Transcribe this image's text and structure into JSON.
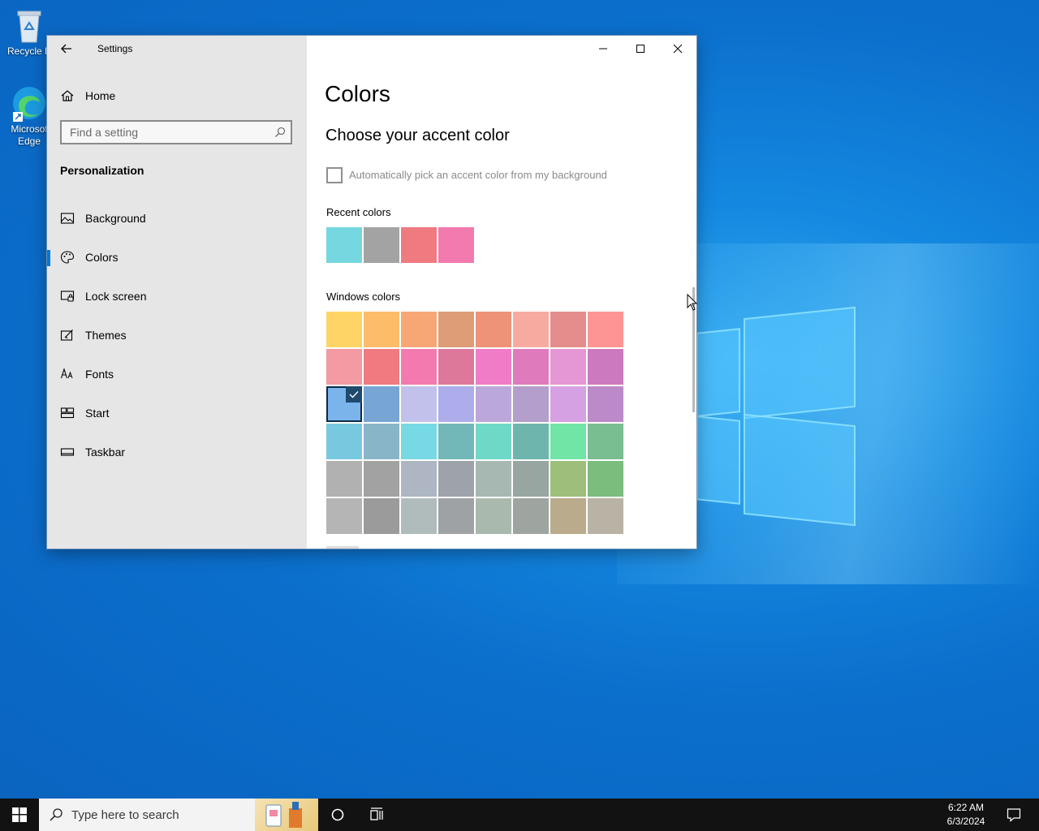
{
  "desktop": {
    "icons": [
      {
        "label": "Recycle B"
      },
      {
        "label_line1": "Microsof",
        "label_line2": "Edge"
      }
    ]
  },
  "window": {
    "title": "Settings",
    "controls": [
      "minimize",
      "maximize",
      "close"
    ]
  },
  "sidebar": {
    "home_label": "Home",
    "search_placeholder": "Find a setting",
    "section": "Personalization",
    "items": [
      {
        "label": "Background",
        "icon": "picture-icon"
      },
      {
        "label": "Colors",
        "icon": "palette-icon",
        "selected": true
      },
      {
        "label": "Lock screen",
        "icon": "lock-screen-icon"
      },
      {
        "label": "Themes",
        "icon": "themes-icon"
      },
      {
        "label": "Fonts",
        "icon": "fonts-icon"
      },
      {
        "label": "Start",
        "icon": "start-icon"
      },
      {
        "label": "Taskbar",
        "icon": "taskbar-icon"
      }
    ]
  },
  "main": {
    "title": "Colors",
    "subtitle": "Choose your accent color",
    "auto_pick_label": "Automatically pick an accent color from my background",
    "auto_pick_checked": false,
    "recent_label": "Recent colors",
    "recent_colors": [
      "#75d7e0",
      "#a3a3a3",
      "#ef7a80",
      "#f27aae"
    ],
    "windows_label": "Windows colors",
    "windows_colors": [
      [
        "#ffd466",
        "#fdbc6a",
        "#f7a776",
        "#de9c77",
        "#ee9377",
        "#f7aba0",
        "#e58d8c",
        "#fd9595"
      ],
      [
        "#f39aa2",
        "#ef7a80",
        "#f27aae",
        "#de789a",
        "#f07bc7",
        "#df7bbd",
        "#e596d5",
        "#cd79c0"
      ],
      [
        "#7ab4eb",
        "#78a6d4",
        "#c1c1ec",
        "#adadec",
        "#bca7da",
        "#b39ecc",
        "#d6a1e2",
        "#bd8ac9"
      ],
      [
        "#78c9e0",
        "#89b5c8",
        "#77d9e3",
        "#73b8b8",
        "#6fd8c7",
        "#6db5ad",
        "#71e5a6",
        "#79be91"
      ],
      [
        "#b1b1b1",
        "#a2a2a2",
        "#adb6c2",
        "#9ea3ab",
        "#a7b8b3",
        "#97a6a0",
        "#9ebf7b",
        "#7abd7d"
      ],
      [
        "#b5b5b5",
        "#9b9b9b",
        "#afbcbb",
        "#9ea2a4",
        "#aab9ad",
        "#9ea5a0",
        "#b9ab8b",
        "#b8b3a4"
      ]
    ],
    "selected_color": {
      "row": 2,
      "col": 0
    }
  },
  "taskbar": {
    "search_placeholder": "Type here to search",
    "time": "6:22 AM",
    "date": "6/3/2024"
  }
}
